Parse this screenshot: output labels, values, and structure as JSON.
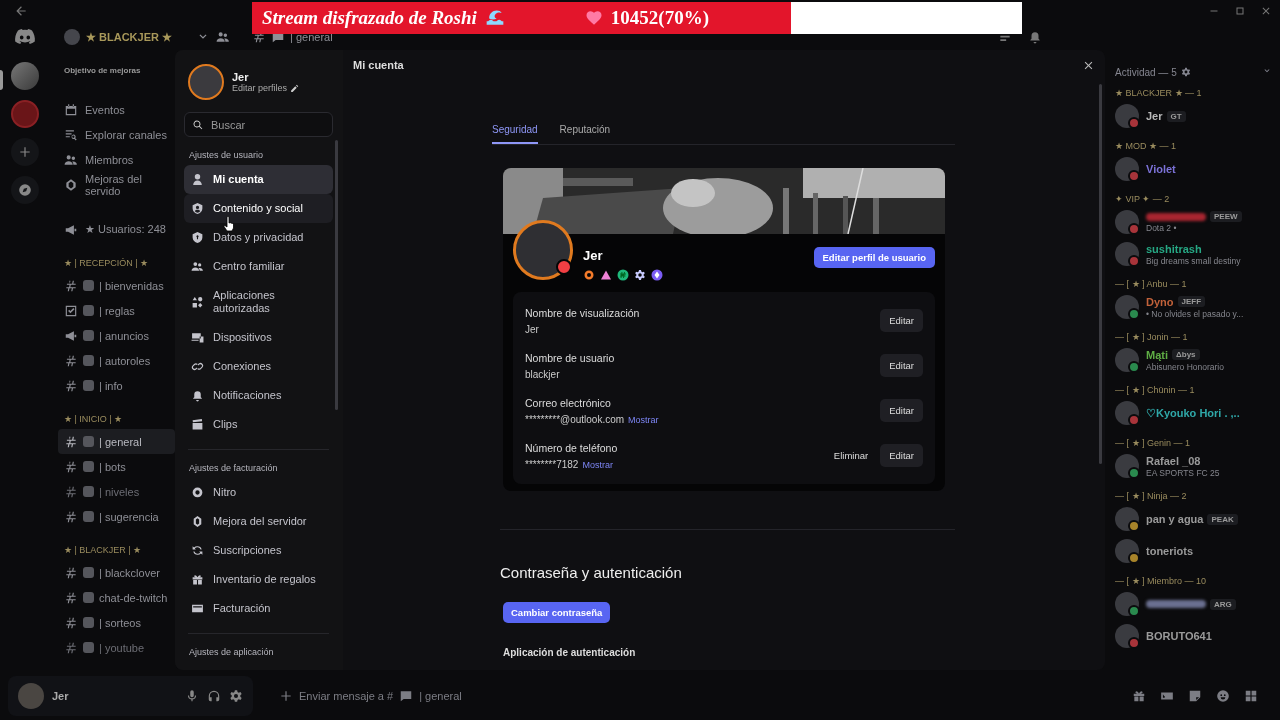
{
  "stream_banner": {
    "title": "Stream disfrazado de Roshi",
    "count": "10452(70%)",
    "level": 0.7
  },
  "server": {
    "name": "★ BLACKJER ★",
    "boost_goal": "Objetivo de mejoras",
    "menu": [
      "Eventos",
      "Explorar canales",
      "Miembros",
      "Mejoras del servido"
    ],
    "stat_channel": "★ Usuarios: 248",
    "categories": [
      {
        "name": "★ | RECEPCIÓN | ★",
        "channels": [
          {
            "name": "| bienvenidas",
            "kind": "text",
            "selected": false,
            "muted": false
          },
          {
            "name": "| reglas",
            "kind": "rules",
            "selected": false,
            "muted": false
          },
          {
            "name": "| anuncios",
            "kind": "announcement",
            "selected": false,
            "muted": false
          },
          {
            "name": "| autoroles",
            "kind": "text",
            "selected": false,
            "muted": false
          },
          {
            "name": "| info",
            "kind": "text",
            "selected": false,
            "muted": false
          }
        ]
      },
      {
        "name": "★ | INICIO | ★",
        "channels": [
          {
            "name": "| general",
            "kind": "text",
            "selected": true,
            "muted": false
          },
          {
            "name": "| bots",
            "kind": "text",
            "selected": false,
            "muted": false
          },
          {
            "name": "| niveles",
            "kind": "text",
            "selected": false,
            "muted": true
          },
          {
            "name": "| sugerencia",
            "kind": "text",
            "selected": false,
            "muted": false
          }
        ]
      },
      {
        "name": "★ | BLACKJER | ★",
        "channels": [
          {
            "name": "| blackclover",
            "kind": "text",
            "selected": false,
            "muted": false
          },
          {
            "name": "chat-de-twitch",
            "kind": "text",
            "selected": false,
            "muted": false
          },
          {
            "name": "| sorteos",
            "kind": "text",
            "selected": false,
            "muted": false
          },
          {
            "name": "| youtube",
            "kind": "text",
            "selected": false,
            "muted": true
          }
        ]
      }
    ]
  },
  "chat_header": {
    "channel": "| general"
  },
  "members": {
    "header": "Actividad — 5",
    "groups": [
      {
        "title": "★ BLACKJER ★ — 1",
        "members": [
          {
            "name": "Jer",
            "color": "#b8b8b8",
            "tag": "GT",
            "status_dot": {
              "color": "#a8343a"
            }
          }
        ]
      },
      {
        "title": "★ MOD ★ — 1",
        "members": [
          {
            "name": "Violet",
            "color": "#7c72d8",
            "status_dot": {
              "color": "#a8343a"
            }
          }
        ]
      },
      {
        "title": "✦ VIP ✦ — 2",
        "members": [
          {
            "color": "#a82530",
            "tag": "PEEW",
            "status": "Dota 2 •",
            "status_dot": {
              "color": "#a8343a"
            }
          },
          {
            "name": "sushitrash",
            "color": "#26a884",
            "status": "Big dreams small destiny",
            "status_dot": {
              "color": "#a8343a"
            }
          }
        ]
      },
      {
        "title": "— [ ★ ] Anbu — 1",
        "members": [
          {
            "name": "Dyno",
            "color": "#c2623a",
            "tag": "JEFF",
            "status": "• No olvides el pasado y...",
            "status_dot": {
              "color": "#2a8a4e"
            }
          }
        ]
      },
      {
        "title": "— [ ★ ] Jonin — 1",
        "members": [
          {
            "name": "Mąti",
            "color": "#5fae45",
            "tag": "Δbys",
            "status": "Abisunero Honorario",
            "status_dot": {
              "color": "#2a8a4e"
            }
          }
        ]
      },
      {
        "title": "— [ ★ ] Chūnin — 1",
        "members": [
          {
            "name": "♡Kyouko Hori . ,..",
            "color": "#2fa8a8",
            "status_dot": {
              "color": "#a8343a"
            }
          }
        ]
      },
      {
        "title": "— [ ★ ] Genin — 1",
        "members": [
          {
            "name": "Rafael _08",
            "color": "#9a9a9a",
            "status": "EA SPORTS FC 25",
            "status_dot": {
              "color": "#2a8a4e"
            }
          }
        ]
      },
      {
        "title": "— [ ★ ] Ninja — 2",
        "members": [
          {
            "name": "pan y agua",
            "color": "#9a9a9a",
            "tag": "PEAK",
            "status_dot": {
              "color": "#a8842a"
            }
          },
          {
            "name": "toneriots",
            "color": "#9a9a9a",
            "status_dot": {
              "color": "#a8842a"
            }
          }
        ]
      },
      {
        "title": "— [ ★ ] Miembro — 10",
        "members": [
          {
            "color": "#6a6f90",
            "tag": "ARG",
            "status_dot": {
              "color": "#2a8a4e"
            }
          },
          {
            "name": "BORUTO641",
            "color": "#9a9a9a",
            "status_dot": {
              "color": "#a8343a"
            }
          }
        ]
      }
    ]
  },
  "user_panel": {
    "name": "Jer"
  },
  "message_field": {
    "placeholder_start": "Enviar mensaje a #",
    "placeholder_channel": "| general"
  },
  "settings": {
    "profile": {
      "name": "Jer",
      "edit_link": "Editar perfiles"
    },
    "search": {
      "placeholder": "Buscar"
    },
    "sections": [
      {
        "title": "Ajustes de usuario",
        "items": [
          {
            "label": "Mi cuenta",
            "selected": true,
            "hovered": false
          },
          {
            "label": "Contenido y social",
            "selected": false,
            "hovered": true
          },
          {
            "label": "Datos y privacidad",
            "selected": false,
            "hovered": false
          },
          {
            "label": "Centro familiar",
            "selected": false,
            "hovered": false
          },
          {
            "label": "Aplicaciones autorizadas",
            "selected": false,
            "hovered": false
          },
          {
            "label": "Dispositivos",
            "selected": false,
            "hovered": false
          },
          {
            "label": "Conexiones",
            "selected": false,
            "hovered": false
          },
          {
            "label": "Notificaciones",
            "selected": false,
            "hovered": false
          },
          {
            "label": "Clips",
            "selected": false,
            "hovered": false
          }
        ]
      },
      {
        "title": "Ajustes de facturación",
        "items": [
          {
            "label": "Nitro",
            "selected": false,
            "hovered": false
          },
          {
            "label": "Mejora del servidor",
            "selected": false,
            "hovered": false
          },
          {
            "label": "Suscripciones",
            "selected": false,
            "hovered": false
          },
          {
            "label": "Inventario de regalos",
            "selected": false,
            "hovered": false
          },
          {
            "label": "Facturación",
            "selected": false,
            "hovered": false
          }
        ]
      },
      {
        "title": "Ajustes de aplicación"
      }
    ],
    "page_title": "Mi cuenta",
    "tabs": [
      {
        "label": "Seguridad",
        "selected": true
      },
      {
        "label": "Reputación",
        "selected": false
      }
    ],
    "profile_card": {
      "name": "Jer",
      "edit_button": "Editar perfil de usuario",
      "status_dot": {
        "color": "#f23f43"
      },
      "fields": [
        {
          "label": "Nombre de visualización",
          "value": "Jer",
          "actions": [
            {
              "label": "Editar",
              "kind": "button"
            }
          ]
        },
        {
          "label": "Nombre de usuario",
          "value": "blackjer",
          "actions": [
            {
              "label": "Editar",
              "kind": "button"
            }
          ]
        },
        {
          "label": "Correo electrónico",
          "value": "*********@outlook.com",
          "reveal": "Mostrar",
          "actions": [
            {
              "label": "Editar",
              "kind": "button"
            }
          ]
        },
        {
          "label": "Número de teléfono",
          "value": "********7182",
          "reveal": "Mostrar",
          "actions": [
            {
              "label": "Eliminar",
              "kind": "link"
            },
            {
              "label": "Editar",
              "kind": "button"
            }
          ]
        }
      ]
    },
    "password_section": {
      "heading": "Contraseña y autenticación",
      "button": "Cambiar contraseña",
      "subheading": "Aplicación de autenticación"
    }
  }
}
